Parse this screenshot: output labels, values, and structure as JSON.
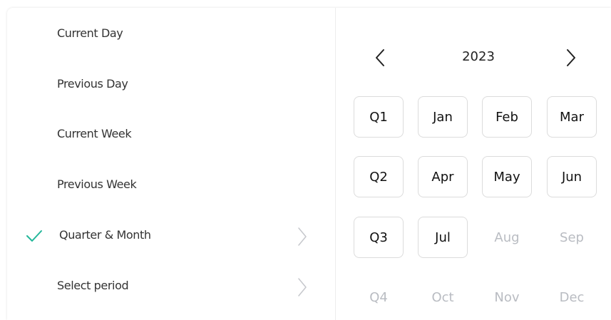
{
  "period_menu": {
    "items": [
      {
        "label": "Current Day"
      },
      {
        "label": "Previous Day"
      },
      {
        "label": "Current Week"
      },
      {
        "label": "Previous Week"
      },
      {
        "label": "Quarter & Month",
        "selected": true,
        "has_submenu": true
      },
      {
        "label": "Select period",
        "has_submenu": true
      }
    ]
  },
  "calendar": {
    "year": "2023",
    "rows": [
      [
        {
          "label": "Q1",
          "enabled": true
        },
        {
          "label": "Jan",
          "enabled": true
        },
        {
          "label": "Feb",
          "enabled": true
        },
        {
          "label": "Mar",
          "enabled": true
        }
      ],
      [
        {
          "label": "Q2",
          "enabled": true
        },
        {
          "label": "Apr",
          "enabled": true
        },
        {
          "label": "May",
          "enabled": true
        },
        {
          "label": "Jun",
          "enabled": true
        }
      ],
      [
        {
          "label": "Q3",
          "enabled": true
        },
        {
          "label": "Jul",
          "enabled": true
        },
        {
          "label": "Aug",
          "enabled": false
        },
        {
          "label": "Sep",
          "enabled": false
        }
      ],
      [
        {
          "label": "Q4",
          "enabled": false
        },
        {
          "label": "Oct",
          "enabled": false
        },
        {
          "label": "Nov",
          "enabled": false
        },
        {
          "label": "Dec",
          "enabled": false
        }
      ]
    ]
  },
  "colors": {
    "accent": "#23b79a",
    "text": "#333333",
    "disabled_text": "#b9bcc2",
    "border": "#dcdcdc"
  },
  "icons": {
    "selected": "check-icon",
    "submenu": "chevron-right-icon",
    "prev_year": "chevron-left-icon",
    "next_year": "chevron-right-icon"
  }
}
